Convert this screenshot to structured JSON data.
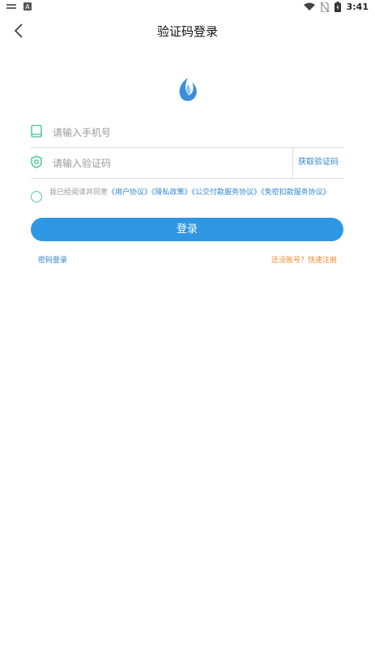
{
  "status_bar": {
    "time": "3:41",
    "left_icons": [
      "notification-icon",
      "app-store-icon"
    ],
    "right_icons": [
      "wifi-icon",
      "no-sim-icon",
      "battery-icon"
    ]
  },
  "header": {
    "title": "验证码登录",
    "back_icon": "chevron-left-icon"
  },
  "form": {
    "phone_placeholder": "请输入手机号",
    "phone_value": "",
    "code_placeholder": "请输入验证码",
    "code_value": "",
    "get_code_label": "获取验证码"
  },
  "agreement": {
    "prefix": "我已经阅读并同意",
    "links": [
      "《用户协议》",
      "《陵私政策》",
      "《公交付款服务协议》",
      "《免密扣款服务协议》"
    ]
  },
  "login_label": "登录",
  "password_login_label": "密码登录",
  "register_label": "还没账号？快速注册",
  "colors": {
    "accent": "#2f96e4",
    "link": "#2f86d2",
    "icon_green": "#3dbb8f",
    "register_orange": "#f28a2e"
  }
}
